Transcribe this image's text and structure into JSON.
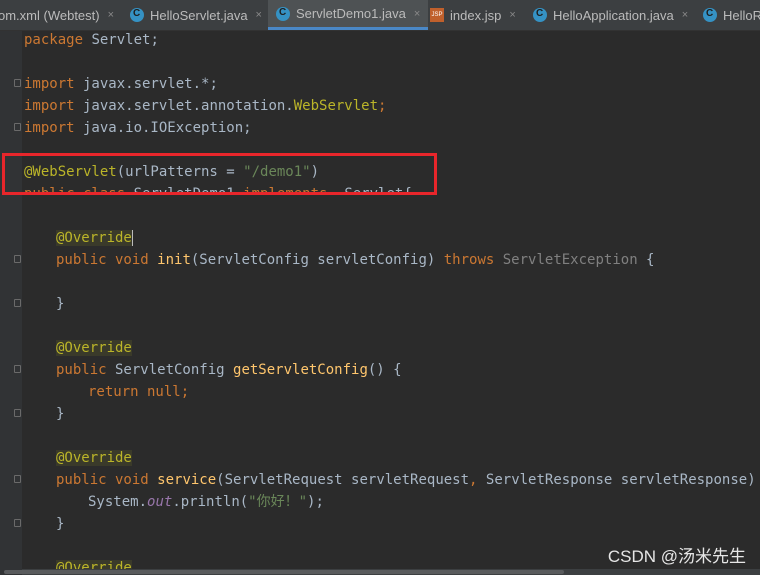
{
  "tabs": [
    {
      "label": "om.xml (Webtest)",
      "icon": "maven-icon"
    },
    {
      "label": "HelloServlet.java",
      "icon": "java-class-icon"
    },
    {
      "label": "ServletDemo1.java",
      "icon": "java-class-icon",
      "active": true
    },
    {
      "label": "index.jsp",
      "icon": "jsp-file-icon"
    },
    {
      "label": "HelloApplication.java",
      "icon": "java-class-icon"
    },
    {
      "label": "HelloR",
      "icon": "java-class-icon"
    }
  ],
  "close_glyph": "×",
  "code": {
    "l1": {
      "kw": "package",
      "rest": " Servlet;"
    },
    "l3": {
      "kw": "import",
      "rest": " javax.servlet.*;"
    },
    "l4": {
      "kw": "import",
      "rest": " javax.servlet.annotation.",
      "ann": "WebServlet",
      "end": ";"
    },
    "l5": {
      "kw": "import",
      "rest": " java.io.IOException;"
    },
    "l7": {
      "ann": "@WebServlet",
      "a": "(urlPatterns = ",
      "str": "\"/demo1\"",
      "b": ")"
    },
    "l8": {
      "kw1": "public class",
      "name": " ServletDemo1 ",
      "kw2": "implements",
      "rest": "  Servlet{"
    },
    "l10": {
      "ann": "@Override"
    },
    "l11": {
      "kw": "public void ",
      "fn": "init",
      "a": "(ServletConfig servletConfig) ",
      "kw2": "throws",
      "gray": " ServletException",
      "b": " {"
    },
    "l13": {
      "text": "}"
    },
    "l15": {
      "ann": "@Override"
    },
    "l16": {
      "kw": "public",
      "a": " ServletConfig ",
      "fn": "getServletConfig",
      "b": "() {"
    },
    "l17": {
      "kw": "return null",
      "b": ";"
    },
    "l18": {
      "text": "}"
    },
    "l20": {
      "ann": "@Override"
    },
    "l21": {
      "kw": "public void ",
      "fn": "service",
      "a": "(ServletRequest servletRequest",
      "comma": ",",
      "b": " ServletResponse servletResponse) ",
      "kw2": "thro"
    },
    "l22": {
      "a": "System.",
      "static": "out",
      "b": ".println(",
      "str": "\"你好！\"",
      "c": ");"
    },
    "l23": {
      "text": "}"
    },
    "l25": {
      "ann": "@Override"
    }
  },
  "watermark": "CSDN @汤米先生",
  "colors": {
    "highlight": "#e8262b",
    "tab_active_underline": "#4a88c7"
  }
}
